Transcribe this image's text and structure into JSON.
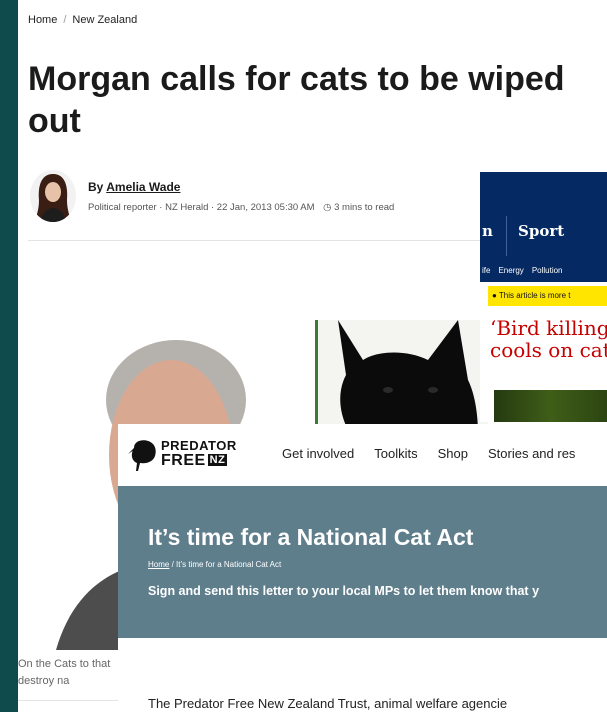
{
  "herald": {
    "breadcrumb": [
      "Home",
      "New Zealand"
    ],
    "breadcrumb_sep": "/",
    "headline": "Morgan calls for cats to be wiped out",
    "byline_prefix": "By",
    "author": "Amelia Wade",
    "meta": "Political reporter · NZ Herald · 22 Jan, 2013 05:30 AM",
    "read_time": "3 mins to read",
    "caption": "On the Cats to that destroy na"
  },
  "guardian": {
    "nav_left": "n",
    "nav_sport": "Sport",
    "subnav": [
      "ife",
      "Energy",
      "Pollution"
    ],
    "banner": "This article is more t",
    "headline_line1": "‘Bird killing",
    "headline_line2": "cools on cat"
  },
  "predator_free": {
    "logo_line1": "PREDATOR",
    "logo_line2": "FREE",
    "logo_nz": "NZ",
    "nav": [
      "Get involved",
      "Toolkits",
      "Shop",
      "Stories and res"
    ],
    "title": "It’s time for a National Cat Act",
    "crumb_home": "Home",
    "crumb_rest": " / It’s time for a National Cat Act",
    "subtitle": "Sign and send this letter to your local MPs to let them know that y",
    "body": "The Predator Free New Zealand Trust, animal welfare agencie"
  },
  "colors": {
    "background": "#0f4a4c",
    "guardian_blue": "#052962",
    "guardian_red": "#c70000",
    "pf_hero": "#5e7e8c"
  }
}
